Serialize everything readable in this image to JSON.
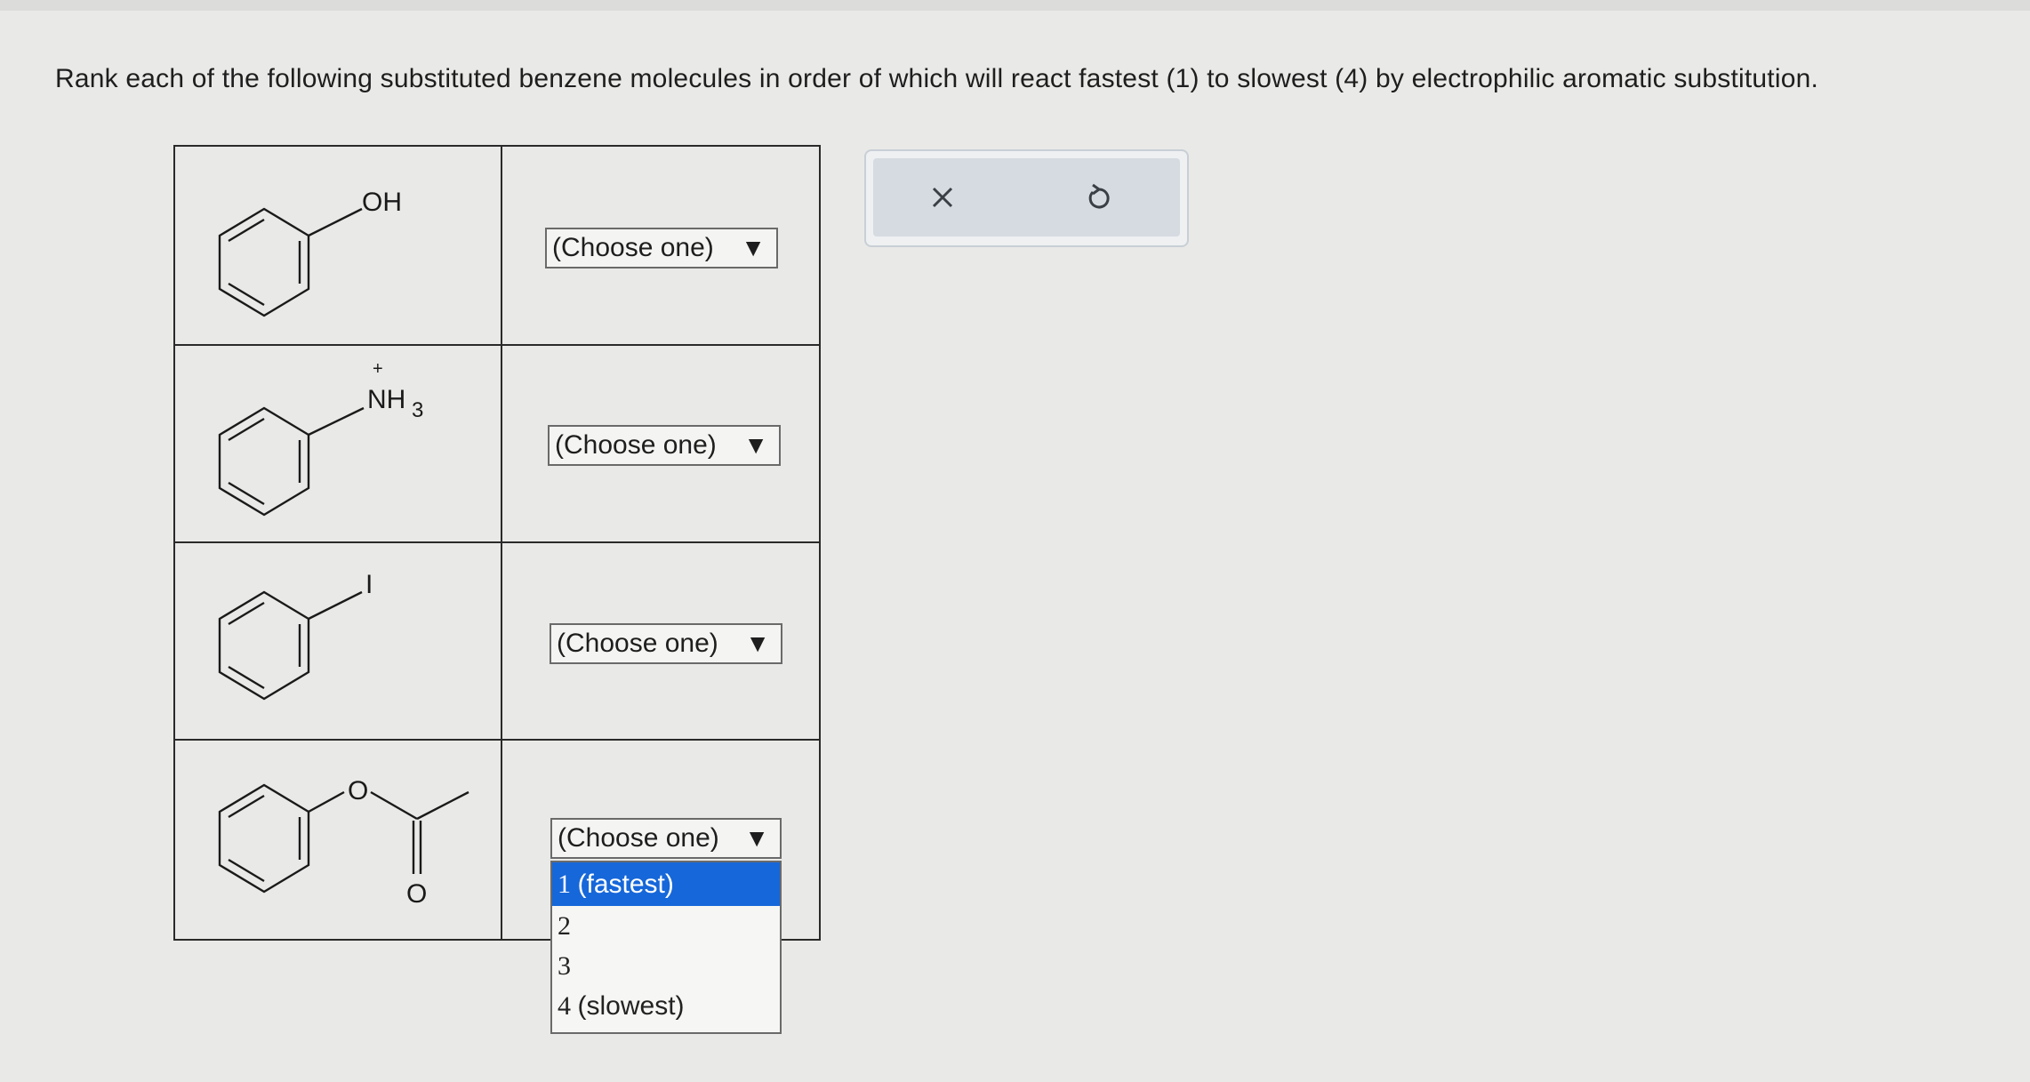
{
  "prompt": "Rank each of the following substituted benzene molecules in order of which will react fastest (1) to slowest (4) by electrophilic aromatic substitution.",
  "molecules": [
    {
      "substituent": "OH"
    },
    {
      "charge": "+",
      "substituent_main": "NH",
      "substituent_sub": "3"
    },
    {
      "substituent": "I"
    },
    {
      "ester_o": "O",
      "carbonyl_o": "O"
    }
  ],
  "rows": [
    {
      "select_value": "(Choose one)"
    },
    {
      "select_value": "(Choose one)"
    },
    {
      "select_value": "(Choose one)"
    },
    {
      "select_value": "(Choose one)"
    }
  ],
  "select_caret": "▼",
  "dropdown": {
    "options": [
      {
        "number": "1",
        "label": "(fastest)"
      },
      {
        "number": "2",
        "label": ""
      },
      {
        "number": "3",
        "label": ""
      },
      {
        "number": "4",
        "label": "(slowest)"
      }
    ],
    "highlighted_index": 0
  },
  "toolbar": {
    "clear_icon": "x-icon",
    "undo_icon": "undo-icon"
  },
  "colors": {
    "highlight": "#1667d9",
    "toolbar_bg": "#d6dbe1"
  }
}
